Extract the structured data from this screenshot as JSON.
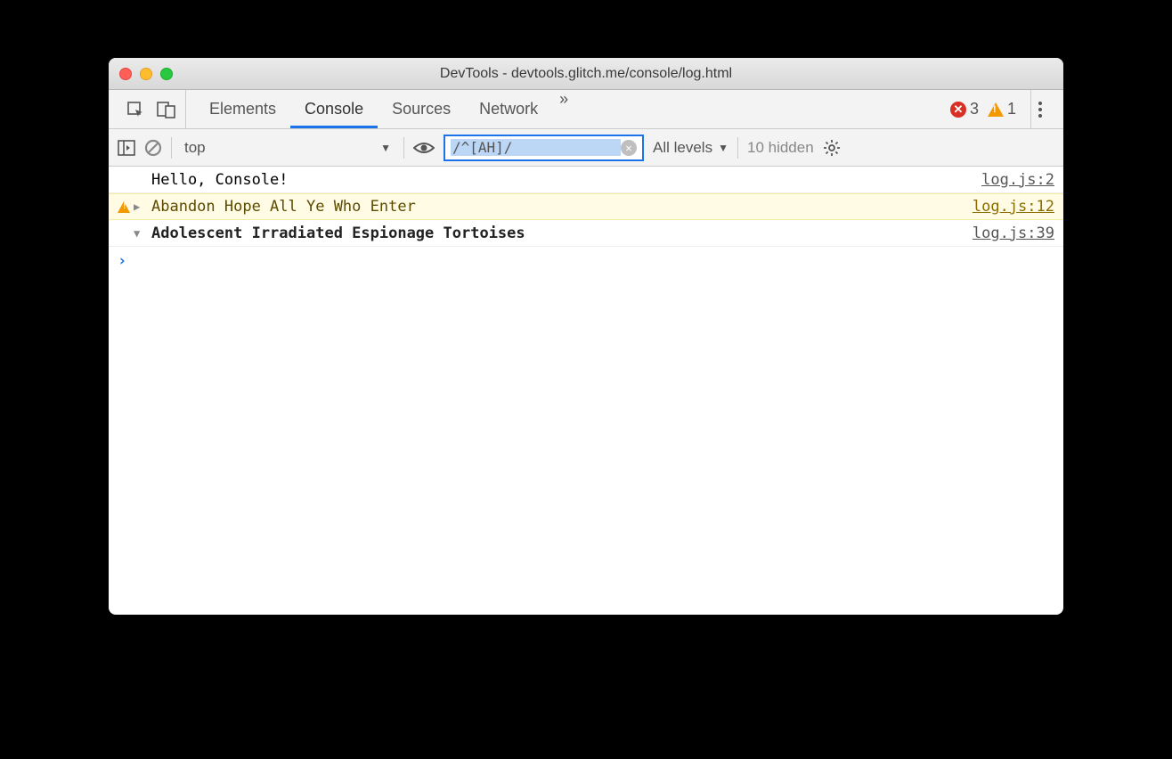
{
  "window": {
    "title": "DevTools - devtools.glitch.me/console/log.html"
  },
  "tabs": {
    "items": [
      "Elements",
      "Console",
      "Sources",
      "Network"
    ],
    "active": "Console",
    "errors": "3",
    "warnings": "1"
  },
  "toolbar": {
    "context": "top",
    "filter": "/^[AH]/",
    "levels_label": "All levels",
    "hidden_label": "10 hidden"
  },
  "logs": [
    {
      "type": "log",
      "text": "Hello, Console!",
      "source": "log.js:2"
    },
    {
      "type": "warn",
      "expandable": true,
      "expanded": false,
      "text": "Abandon Hope All Ye Who Enter",
      "source": "log.js:12"
    },
    {
      "type": "group",
      "expandable": true,
      "expanded": true,
      "bold": true,
      "text": "Adolescent Irradiated Espionage Tortoises",
      "source": "log.js:39"
    }
  ],
  "prompt": {
    "caret": "›"
  }
}
